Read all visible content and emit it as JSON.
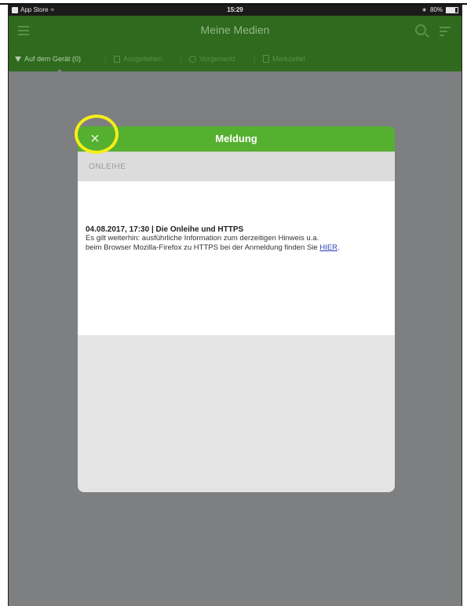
{
  "status_bar": {
    "carrier": "App Store",
    "time": "15:29",
    "battery": "80%"
  },
  "nav": {
    "title": "Meine Medien"
  },
  "tabs": [
    {
      "label": "Auf dem Gerät (0)",
      "icon": "download-icon"
    },
    {
      "label": "Ausgeliehen",
      "icon": "bookmark-icon"
    },
    {
      "label": "Vorgemerkt",
      "icon": "clock-icon"
    },
    {
      "label": "Merkzettel",
      "icon": "note-icon"
    }
  ],
  "modal": {
    "close_label": "×",
    "title": "Meldung",
    "section": "ONLEIHE",
    "message_title": "04.08.2017, 17:30 | Die Onleihe und HTTPS",
    "message_line1": "Es gilt weiterhin: ausführliche Information zum derzeitigen Hinweis u.a.",
    "message_line2_prefix": "beim Browser Mozilla-Firefox zu HTTPS bei der Anmeldung finden Sie ",
    "message_link": "HIER",
    "message_line2_suffix": "."
  },
  "colors": {
    "header_green_dimmed": "#2f6a1e",
    "modal_header_green": "#56b02f",
    "overlay_gray": "#7d7f80",
    "highlight_yellow": "#f5ee19",
    "link_blue": "#2a3fb8"
  }
}
